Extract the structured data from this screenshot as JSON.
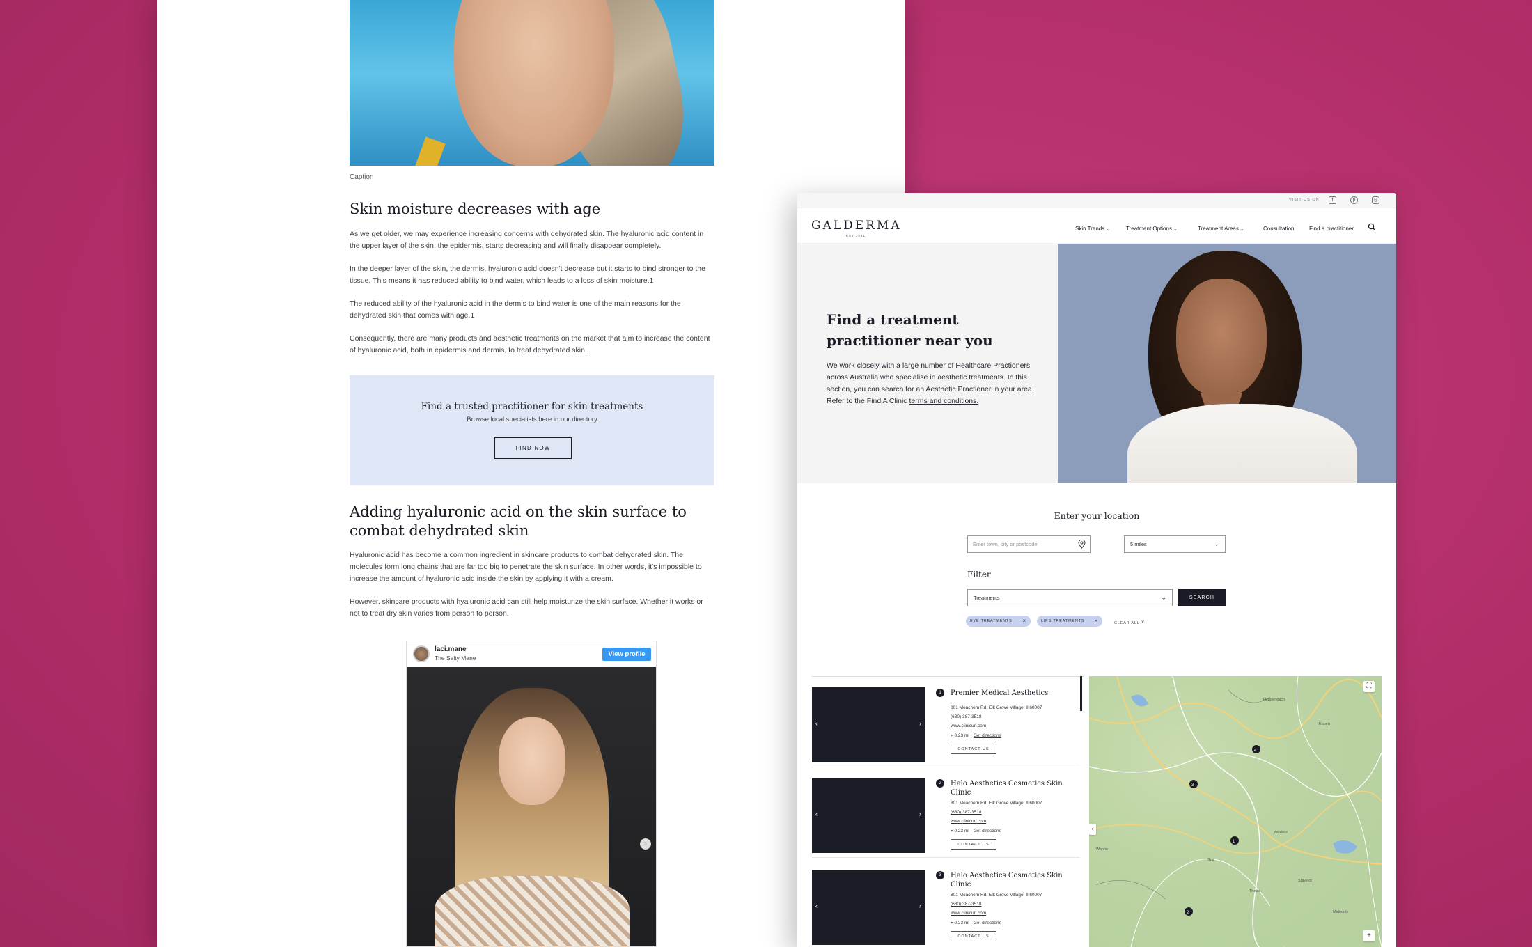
{
  "article": {
    "caption": "Caption",
    "heading1": "Skin moisture decreases with age",
    "p1": "As we get older, we may experience increasing concerns with dehydrated skin. The hyaluronic acid content in the upper layer of the skin, the epidermis, starts decreasing and will finally disappear completely.",
    "p2": "In the deeper layer of the skin, the dermis, hyaluronic acid doesn't decrease but it starts to bind stronger to the tissue. This means it has reduced ability to bind water, which leads to a loss of skin moisture.1",
    "p3": "The reduced ability of the hyaluronic acid in the dermis to bind water is one of the main reasons for the dehydrated skin that comes with age.1",
    "p4": "Consequently, there are many products and aesthetic treatments on the market that aim to increase the content of hyaluronic acid, both in epidermis and dermis, to treat dehydrated skin.",
    "cta": {
      "title": "Find a trusted practitioner for skin treatments",
      "subtitle": "Browse local specialists here in our directory",
      "button": "FIND NOW"
    },
    "heading2": "Adding hyaluronic acid on the skin surface to combat dehydrated skin",
    "p5": "Hyaluronic acid has become a common ingredient in skincare products to combat dehydrated skin. The molecules form long chains that are far too big to penetrate the skin surface. In other words, it's impossible to increase the amount of hyaluronic acid inside the skin by applying it with a cream.",
    "p6": "However, skincare products with hyaluronic acid can still help moisturize the skin surface. Whether it works or not to treat dry skin varies from person to person.",
    "instagram": {
      "username": "laci.mane",
      "subtitle": "The Salty Mane",
      "button": "View profile",
      "button_color": "#3897f0"
    }
  },
  "site": {
    "topbar": {
      "visit_label": "VISIT US ON",
      "icons": [
        "facebook-icon",
        "pinterest-icon",
        "instagram-icon"
      ]
    },
    "logo": "GALDERMA",
    "logo_sub": "EST 1981",
    "nav": [
      {
        "label": "Skin Trends",
        "has_dropdown": true
      },
      {
        "label": "Treatment Options",
        "has_dropdown": true
      },
      {
        "label": "Treatment Areas",
        "has_dropdown": true
      },
      {
        "label": "Consultation",
        "has_dropdown": false
      },
      {
        "label": "Find a practitioner",
        "has_dropdown": false
      }
    ],
    "hero": {
      "title": "Find a treatment practitioner near you",
      "text": "We work closely with a large number of Healthcare Practioners across Australia who specialise in aesthetic treatments. In this section, you can search for an Aesthetic Practioner in your area.",
      "refer_prefix": "Refer to the Find A Clinic ",
      "refer_link": "terms and conditions."
    },
    "search": {
      "location_title": "Enter your location",
      "location_placeholder": "Enter town, city or postcode",
      "radius_value": "5 miles",
      "filter_label": "Filter",
      "treatments_value": "Treatments",
      "search_button": "SEARCH",
      "tags": [
        "EYE TREATMENTS",
        "LIPS TREATMENTS"
      ],
      "clear_all": "CLEAR ALL",
      "accent_color": "#1a1b24",
      "tag_color": "#c7d1ef"
    },
    "results": [
      {
        "num": "1",
        "name": "Premier Medical Aesthetics",
        "address": "801 Meachem Rd, Elk Grove Village, Il 60007",
        "phone": "(630) 387-3518",
        "web": "www.clinicurl.com",
        "distance": "0.23 mi",
        "directions": "Get directions",
        "contact": "CONTACT US"
      },
      {
        "num": "2",
        "name": "Halo Aesthetics Cosmetics Skin Clinic",
        "address": "801 Meachem Rd, Elk Grove Village, Il 60007",
        "phone": "(630) 387-3518",
        "web": "www.clinicurl.com",
        "distance": "0.23 mi",
        "directions": "Get directions",
        "contact": "CONTACT US"
      },
      {
        "num": "3",
        "name": "Halo Aesthetics Cosmetics Skin Clinic",
        "address": "801 Meachem Rd, Elk Grove Village, Il 60007",
        "phone": "(630) 387-3518",
        "web": "www.clinicurl.com",
        "distance": "0.23 mi",
        "directions": "Get directions",
        "contact": "CONTACT US"
      }
    ],
    "map": {
      "marker_labels": [
        "4",
        "3",
        "1",
        "2"
      ],
      "labels": [
        "Heppenbach",
        "Verviers",
        "Stavelot",
        "Theux",
        "Spa",
        "Malmedy",
        "Eupen",
        "Wanne"
      ]
    }
  }
}
